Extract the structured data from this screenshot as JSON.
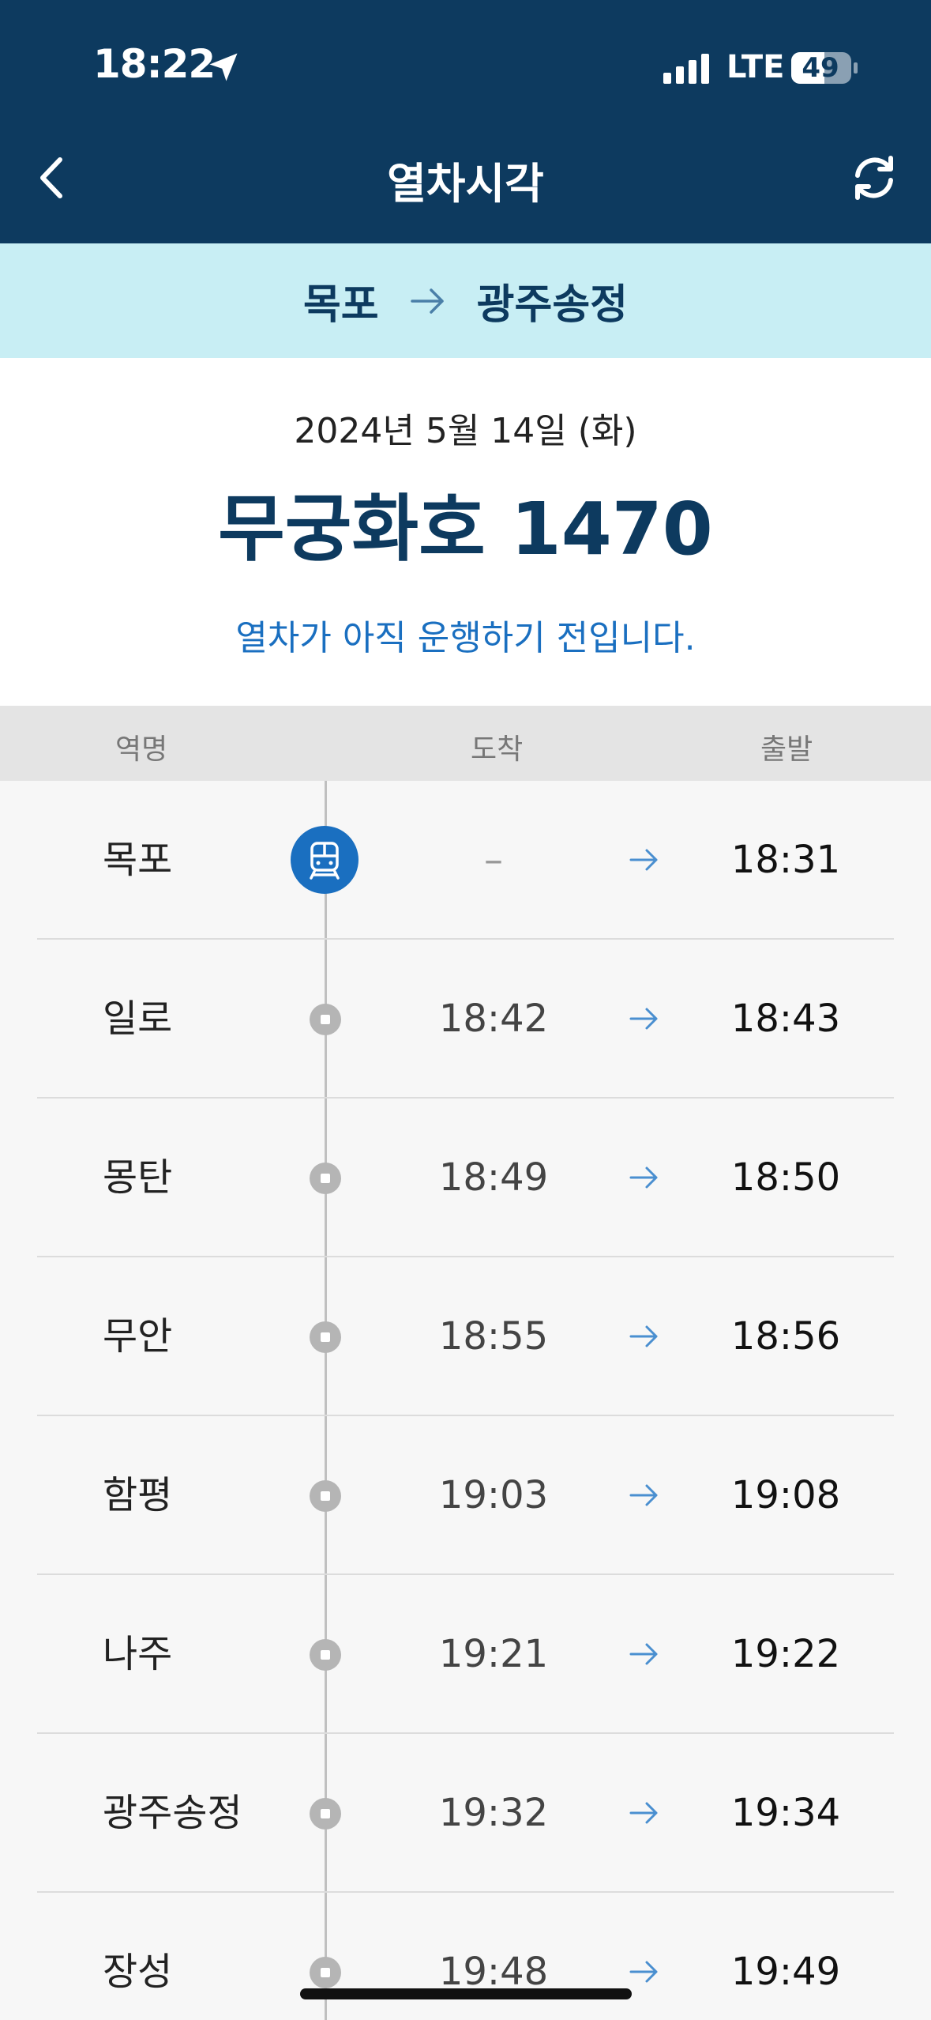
{
  "status_bar": {
    "time": "18:22",
    "network": "LTE",
    "battery": "49"
  },
  "nav": {
    "title": "열차시각"
  },
  "route": {
    "from": "목포",
    "to": "광주송정"
  },
  "info": {
    "date": "2024년 5월 14일 (화)",
    "train": "무궁화호 1470",
    "status": "열차가 아직 운행하기 전입니다."
  },
  "columns": {
    "station": "역명",
    "arrival": "도착",
    "departure": "출발"
  },
  "stops": [
    {
      "station": "목포",
      "arrival": "–",
      "departure": "18:31",
      "current": true
    },
    {
      "station": "일로",
      "arrival": "18:42",
      "departure": "18:43"
    },
    {
      "station": "몽탄",
      "arrival": "18:49",
      "departure": "18:50"
    },
    {
      "station": "무안",
      "arrival": "18:55",
      "departure": "18:56"
    },
    {
      "station": "함평",
      "arrival": "19:03",
      "departure": "19:08"
    },
    {
      "station": "나주",
      "arrival": "19:21",
      "departure": "19:22"
    },
    {
      "station": "광주송정",
      "arrival": "19:32",
      "departure": "19:34"
    },
    {
      "station": "장성",
      "arrival": "19:48",
      "departure": "19:49"
    }
  ],
  "colors": {
    "header": "#0d3a5f",
    "route_bar": "#c8eef4",
    "accent": "#1a6fc0"
  },
  "icons": {
    "back": "chevron-left-icon",
    "refresh": "refresh-icon",
    "train": "train-icon",
    "arrow": "arrow-right-icon"
  }
}
